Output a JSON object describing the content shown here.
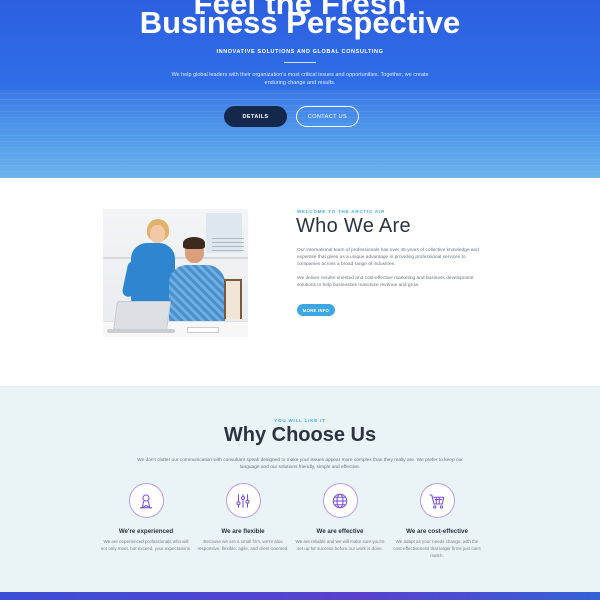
{
  "hero": {
    "title_partial": "Feel the Fresh",
    "title": "Business Perspective",
    "subtitle": "INNOVATIVE SOLUTIONS AND GLOBAL CONSULTING",
    "text": "We help global leaders with their organization's most critical issues and opportunities. Together, we create enduring change and results.",
    "details_label": "DETAILS",
    "contact_label": "CONTACT US"
  },
  "about": {
    "eyebrow": "WELCOME TO THE ARCTIC AIR",
    "heading": "Who We Are",
    "p1": "Our international team of professionals has over 45 years of collective knowledge and expertise that gives us a unique advantage in providing professional services to companies across a broad range of industries.",
    "p2": "We deliver results-oriented and cost-effective marketing and business development solutions to help businesses maximize revenue and grow.",
    "more_label": "MORE INFO"
  },
  "why": {
    "eyebrow": "YOU WILL LIKE IT",
    "heading": "Why Choose Us",
    "intro": "We don't clutter our communication with consultant speak designed to make your issues appear more complex than they really are. We prefer to keep our language and our solutions friendly, simple and effective.",
    "features": [
      {
        "icon": "award-icon",
        "title": "We're experienced",
        "desc": "We are experienced professionals who will not only meet, but exceed, your expectations."
      },
      {
        "icon": "sliders-icon",
        "title": "We are flexible",
        "desc": "Because we are a small firm, we're also responsive, flexible, agile, and client-oriented."
      },
      {
        "icon": "globe-icon",
        "title": "We are effective",
        "desc": "We are reliable and we will make sure you're set up for success before our work is done."
      },
      {
        "icon": "cart-icon",
        "title": "We are cost-effective",
        "desc": "We adapt as your needs change, with the cost-effectiveness that larger firms just can't match."
      }
    ]
  },
  "colors": {
    "accent": "#3da7e4",
    "hero_blue": "#2f6de6",
    "dark_button": "#13284a",
    "icon_ring": "#b99be6",
    "section_bg": "#eaf3f5"
  }
}
